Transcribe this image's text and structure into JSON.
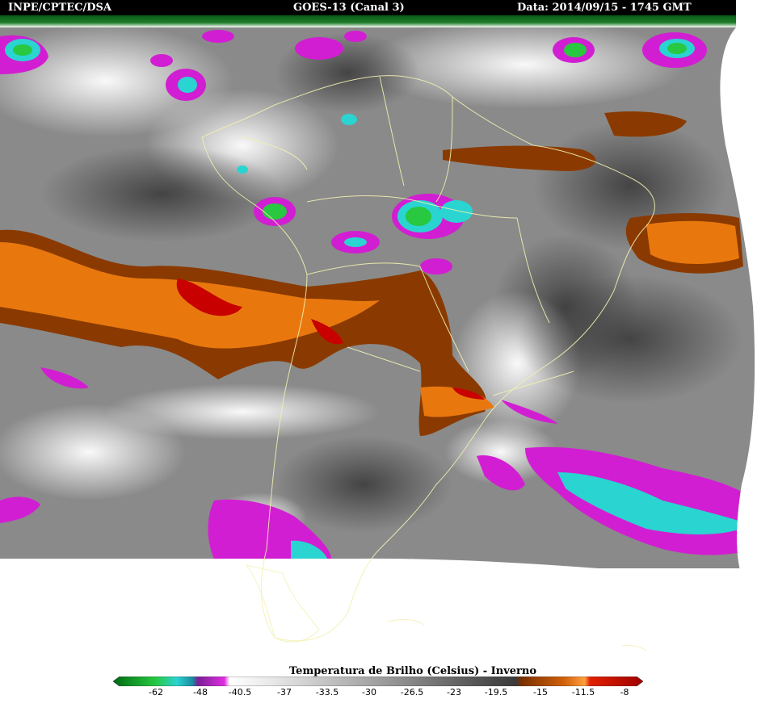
{
  "header": {
    "source": "INPE/CPTEC/DSA",
    "product": "GOES-13 (Canal 3)",
    "datetime": "Data: 2014/09/15 - 1745 GMT"
  },
  "legend": {
    "title": "Temperatura de Brilho (Celsius) - Inverno",
    "ticks": [
      "-62",
      "-48",
      "-40.5",
      "-37",
      "-33.5",
      "-30",
      "-26.5",
      "-23",
      "-19.5",
      "-15",
      "-11.5",
      "-8"
    ],
    "colors": {
      "dark_green": "#007a1a",
      "green": "#28c840",
      "cyan": "#2ad4d0",
      "purple": "#8a1fa8",
      "magenta": "#d21ed2",
      "white": "#ffffff",
      "grey_mid": "#8c8c8c",
      "grey_dark": "#4a4a4a",
      "brown": "#8a3a00",
      "orange": "#e8780e",
      "red": "#c80000"
    }
  }
}
